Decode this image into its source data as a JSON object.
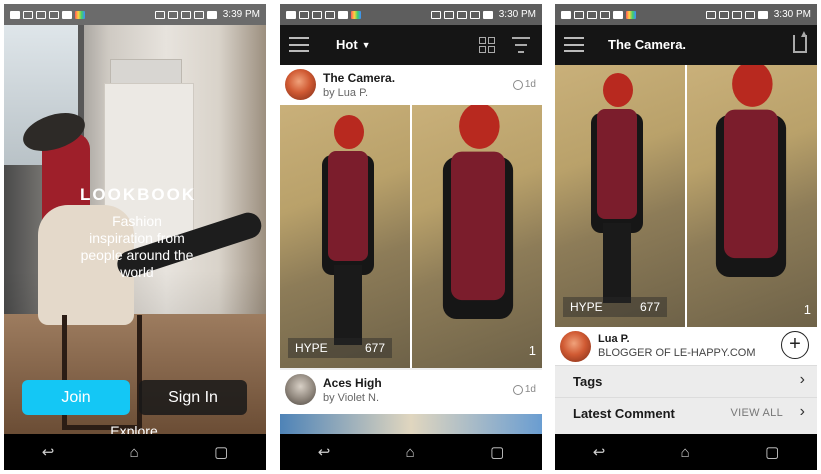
{
  "screens": [
    {
      "status": {
        "time": "3:39 PM"
      },
      "logo": "LOOKBOOK",
      "tagline": "Fashion inspiration from people around the world",
      "buttons": {
        "join": "Join",
        "signin": "Sign In",
        "explore": "Explore"
      },
      "nav": {
        "back": "↩",
        "home": "⌂",
        "recents": "▢"
      }
    },
    {
      "status": {
        "time": "3:30 PM"
      },
      "header": {
        "sort_label": "Hot"
      },
      "posts": [
        {
          "title": "The Camera.",
          "author": "by Lua P.",
          "age": "1d",
          "hype_label": "HYPE",
          "hype_count": "677",
          "image_count": "1"
        },
        {
          "title": "Aces High",
          "author": "by Violet N.",
          "age": "1d"
        }
      ],
      "nav": {
        "back": "↩",
        "home": "⌂",
        "recents": "▢"
      }
    },
    {
      "status": {
        "time": "3:30 PM"
      },
      "header": {
        "title": "The Camera."
      },
      "photo": {
        "hype_label": "HYPE",
        "hype_count": "677",
        "image_count": "1"
      },
      "blogger": {
        "name": "Lua P.",
        "subtitle": "BLOGGER OF LE-HAPPY.COM",
        "follow": "+"
      },
      "sections": {
        "tags": "Tags",
        "latest_comment": "Latest Comment",
        "view_all": "VIEW ALL",
        "chevron": "›"
      },
      "nav": {
        "back": "↩",
        "home": "⌂",
        "recents": "▢"
      }
    }
  ]
}
